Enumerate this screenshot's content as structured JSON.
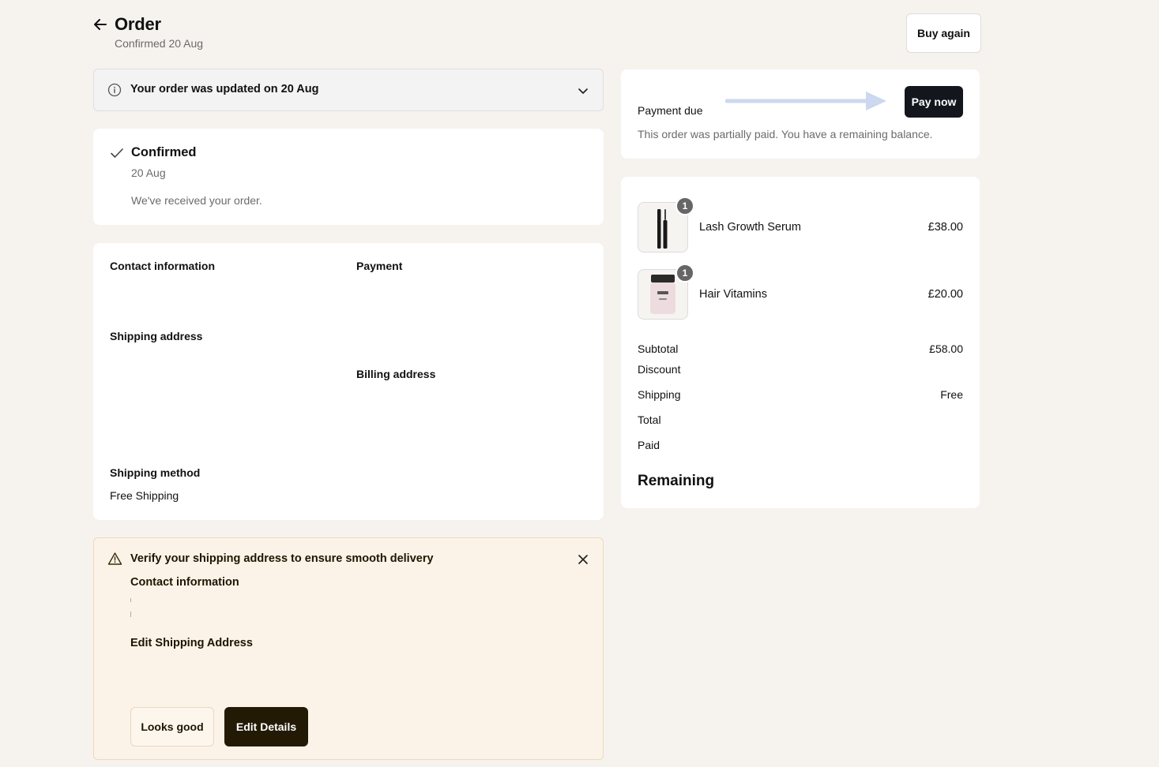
{
  "header": {
    "title": "Order",
    "subtitle": "Confirmed 20 Aug",
    "buy_again_label": "Buy again"
  },
  "update_banner": {
    "text": "Your order was updated on 20 Aug"
  },
  "status_card": {
    "title": "Confirmed",
    "date": "20 Aug",
    "message": "We've received your order."
  },
  "info": {
    "contact_heading": "Contact information",
    "payment_heading": "Payment",
    "shipping_address_heading": "Shipping address",
    "billing_address_heading": "Billing address",
    "shipping_method_heading": "Shipping method",
    "shipping_method_value": "Free Shipping"
  },
  "verify": {
    "title": "Verify your shipping address to ensure smooth delivery",
    "contact_heading": "Contact information",
    "edit_heading": "Edit Shipping Address",
    "looks_good_label": "Looks good",
    "edit_details_label": "Edit Details"
  },
  "payment_due": {
    "label": "Payment due",
    "pay_now_label": "Pay now",
    "note": "This order was partially paid. You have a remaining balance."
  },
  "items": [
    {
      "name": "Lash Growth Serum",
      "qty": "1",
      "price": "£38.00"
    },
    {
      "name": "Hair Vitamins",
      "qty": "1",
      "price": "£20.00"
    }
  ],
  "summary": {
    "subtotal_label": "Subtotal",
    "subtotal_value": "£58.00",
    "discount_label": "Discount",
    "shipping_label": "Shipping",
    "shipping_value": "Free",
    "total_label": "Total",
    "paid_label": "Paid",
    "remaining_label": "Remaining"
  },
  "colors": {
    "page_bg": "#f6f3ee",
    "pay_now_bg": "#13161d",
    "edit_details_bg": "#231a06",
    "verify_bg": "#fcf3e8",
    "arrow": "#c9d6ee"
  }
}
